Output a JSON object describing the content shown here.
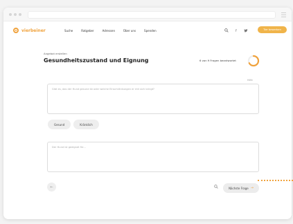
{
  "nav": {
    "logo": "vierbeiner",
    "links": [
      "Suche",
      "Ratgeber",
      "Adressen",
      "Über uns",
      "Spenden"
    ],
    "icons": [
      "search-icon",
      "facebook-icon",
      "twitter-icon"
    ],
    "cta": "Tier bewerben"
  },
  "page": {
    "eyebrow": "Angebot erstellen",
    "title": "Gesundheitszustand und Eignung",
    "progress_text": "6 von 9 Fragen beantwortet",
    "progress_fraction": 0.67,
    "note": "Hilfe",
    "question1_placeholder": "Gibt es, das der Hund gesund ist oder welche Einschränkungen er mit sich bringt?",
    "chips": [
      "Gesund",
      "Kränklich"
    ],
    "question2_placeholder": "Der Hund ist geeignet für...",
    "next_label": "Nächste Frage"
  },
  "colors": {
    "accent": "#f0a23c"
  }
}
